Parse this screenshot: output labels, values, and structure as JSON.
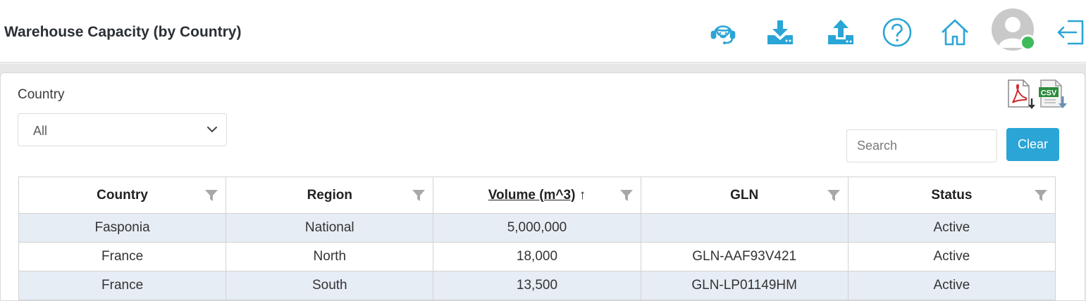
{
  "header": {
    "title": "Warehouse Capacity (by Country)",
    "icons": [
      "support-agent-icon",
      "download-icon",
      "upload-icon",
      "help-icon",
      "home-icon",
      "avatar",
      "logout-icon"
    ]
  },
  "filter": {
    "label": "Country",
    "selected": "All"
  },
  "search": {
    "placeholder": "Search",
    "value": ""
  },
  "clear_label": "Clear",
  "export": {
    "pdf_icon": "pdf-export-icon",
    "csv_icon": "csv-export-icon",
    "csv_text": "CSV"
  },
  "table": {
    "columns": [
      "Country",
      "Region",
      "Volume (m^3)",
      "GLN",
      "Status"
    ],
    "sorted_column": "Volume (m^3)",
    "sort_arrow": "↑",
    "rows": [
      [
        "Fasponia",
        "National",
        "5,000,000",
        "",
        "Active"
      ],
      [
        "France",
        "North",
        "18,000",
        "GLN-AAF93V421",
        "Active"
      ],
      [
        "France",
        "South",
        "13,500",
        "GLN-LP01149HM",
        "Active"
      ]
    ]
  },
  "colors": {
    "accent": "#2aa5d6",
    "online": "#3dbb5b",
    "row_alt": "#e7edf5"
  }
}
